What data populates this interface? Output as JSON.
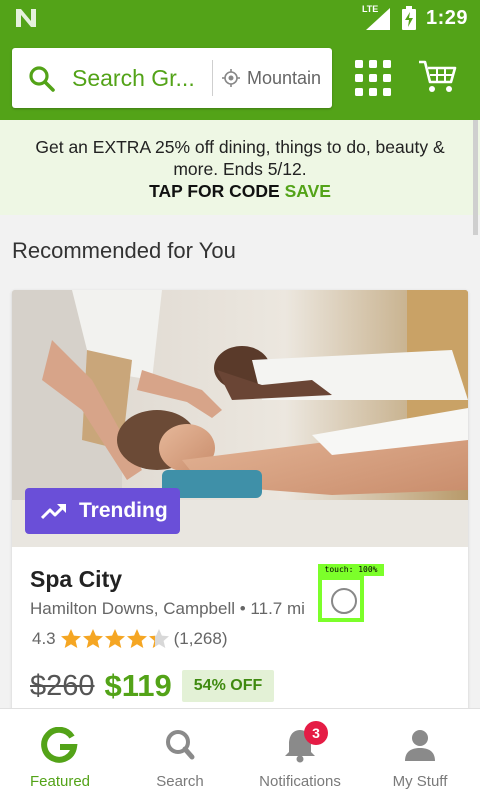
{
  "status_bar": {
    "network": "LTE",
    "time": "1:29"
  },
  "header": {
    "search_placeholder": "Search Gr...",
    "location": "Mountain"
  },
  "promo": {
    "text": "Get an EXTRA 25% off dining, things to do, beauty & more. Ends 5/12.",
    "cta": "TAP FOR CODE",
    "code": "SAVE"
  },
  "section": {
    "title": "Recommended for You"
  },
  "deal": {
    "badge": "Trending",
    "title": "Spa City",
    "location": "Hamilton Downs, Campbell • 11.7 mi",
    "rating": "4.3",
    "rating_value": 4.3,
    "rating_max": 5,
    "reviews": "(1,268)",
    "old_price": "$260",
    "new_price": "$119",
    "discount": "54% OFF"
  },
  "overlay": {
    "touch_label": "touch: 100%"
  },
  "nav": [
    {
      "label": "Featured",
      "icon": "groupon-g-icon",
      "active": true
    },
    {
      "label": "Search",
      "icon": "search-icon",
      "active": false
    },
    {
      "label": "Notifications",
      "icon": "bell-icon",
      "active": false,
      "badge": "3"
    },
    {
      "label": "My Stuff",
      "icon": "person-icon",
      "active": false
    }
  ],
  "colors": {
    "brand_green": "#53a318",
    "trending_purple": "#6a4fd8",
    "badge_red": "#e51c45",
    "promo_bg": "#eef7e4"
  }
}
